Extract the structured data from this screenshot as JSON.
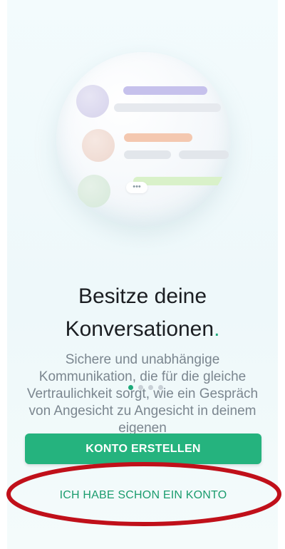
{
  "onboarding": {
    "title_line1": "Besitze deine",
    "title_line2": "Konversationen",
    "title_accent": ".",
    "description": "Sichere und unabhängige Kommunikation, die für die gleiche Vertraulichkeit sorgt, wie ein Gespräch von Angesicht zu Angesicht in deinem eigenen",
    "typing_indicator": "•••",
    "pager": {
      "count": 4,
      "active_index": 0
    }
  },
  "actions": {
    "create_account": "KONTO ERSTELLEN",
    "have_account": "ICH HABE SCHON EIN KONTO"
  },
  "colors": {
    "accent": "#1daa7a",
    "primary_button": "#25b37e",
    "secondary_text": "#1b9c6e",
    "highlight_ellipse": "#c0101a"
  },
  "icons": {
    "illustration": "chat-bubbles-illustration",
    "typing": "typing-dots-icon"
  }
}
